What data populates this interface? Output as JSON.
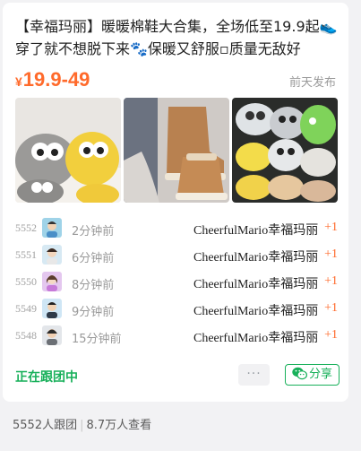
{
  "post": {
    "title": "【幸福玛丽】暖暖棉鞋大合集，全场低至19.9起👟穿了就不想脱下来🐾保暖又舒服▫质量无敌好",
    "price_symbol": "¥",
    "price": "19.9-49",
    "posted": "前天发布"
  },
  "images": [
    {
      "icon": "plush-slippers-gray-yellow-image"
    },
    {
      "icon": "brown-snow-boots-image"
    },
    {
      "icon": "cartoon-slippers-collection-image"
    }
  ],
  "followers": [
    {
      "number": "5552",
      "time": "2分钟前",
      "name": "CheerfulMario幸福玛丽",
      "increment": "+1"
    },
    {
      "number": "5551",
      "time": "6分钟前",
      "name": "CheerfulMario幸福玛丽",
      "increment": "+1"
    },
    {
      "number": "5550",
      "time": "8分钟前",
      "name": "CheerfulMario幸福玛丽",
      "increment": "+1"
    },
    {
      "number": "5549",
      "time": "9分钟前",
      "name": "CheerfulMario幸福玛丽",
      "increment": "+1"
    },
    {
      "number": "5548",
      "time": "15分钟前",
      "name": "CheerfulMario幸福玛丽",
      "increment": "+1"
    }
  ],
  "actions": {
    "following_label": "正在跟团中",
    "more_label": "···",
    "share_label": "分享"
  },
  "stats": {
    "participants": "5552人跟团",
    "views": "8.7万人查看"
  },
  "colors": {
    "accent": "#ff6a2b",
    "green": "#18b05a"
  }
}
